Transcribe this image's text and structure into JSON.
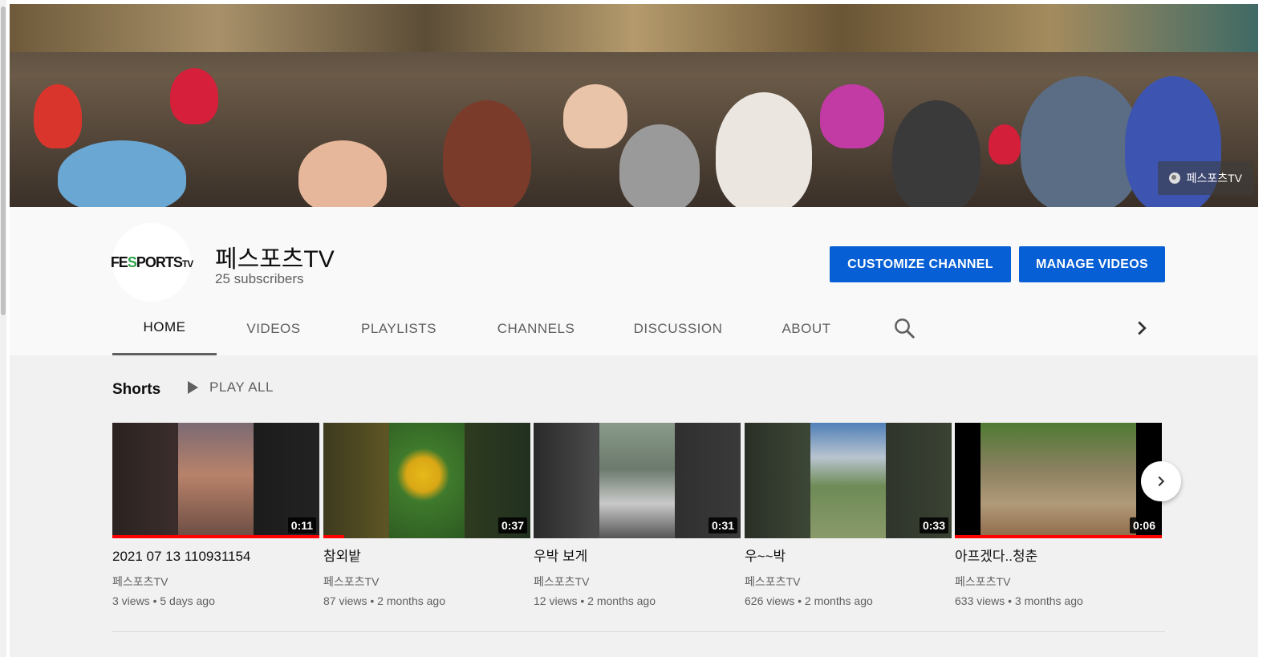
{
  "banner": {
    "badge_label": "페스포츠TV"
  },
  "channel": {
    "name": "페스포츠TV",
    "subscribers": "25 subscribers",
    "logo_text_a": "FE",
    "logo_text_s": "S",
    "logo_text_b": "PORTS",
    "logo_text_tv": "TV"
  },
  "buttons": {
    "customize": "CUSTOMIZE CHANNEL",
    "manage": "MANAGE VIDEOS"
  },
  "tabs": [
    {
      "label": "HOME",
      "active": true
    },
    {
      "label": "VIDEOS"
    },
    {
      "label": "PLAYLISTS"
    },
    {
      "label": "CHANNELS"
    },
    {
      "label": "DISCUSSION"
    },
    {
      "label": "ABOUT"
    }
  ],
  "shelf": {
    "title": "Shorts",
    "play_all": "PLAY ALL",
    "videos": [
      {
        "title": "2021 07 13 110931154",
        "channel": "페스포츠TV",
        "meta": "3 views • 5 days ago",
        "duration": "0:11",
        "watched": 1.0
      },
      {
        "title": "참외밭",
        "channel": "페스포츠TV",
        "meta": "87 views • 2 months ago",
        "duration": "0:37",
        "watched": 0.1
      },
      {
        "title": "우박 보게",
        "channel": "페스포츠TV",
        "meta": "12 views • 2 months ago",
        "duration": "0:31",
        "watched": 0
      },
      {
        "title": "우~~박",
        "channel": "페스포츠TV",
        "meta": "626 views • 2 months ago",
        "duration": "0:33",
        "watched": 0
      },
      {
        "title": "아프겠다..청춘",
        "channel": "페스포츠TV",
        "meta": "633 views • 3 months ago",
        "duration": "0:06",
        "watched": 1.0
      }
    ]
  },
  "colors": {
    "accent": "#065fd4",
    "progress": "#ff0000"
  }
}
